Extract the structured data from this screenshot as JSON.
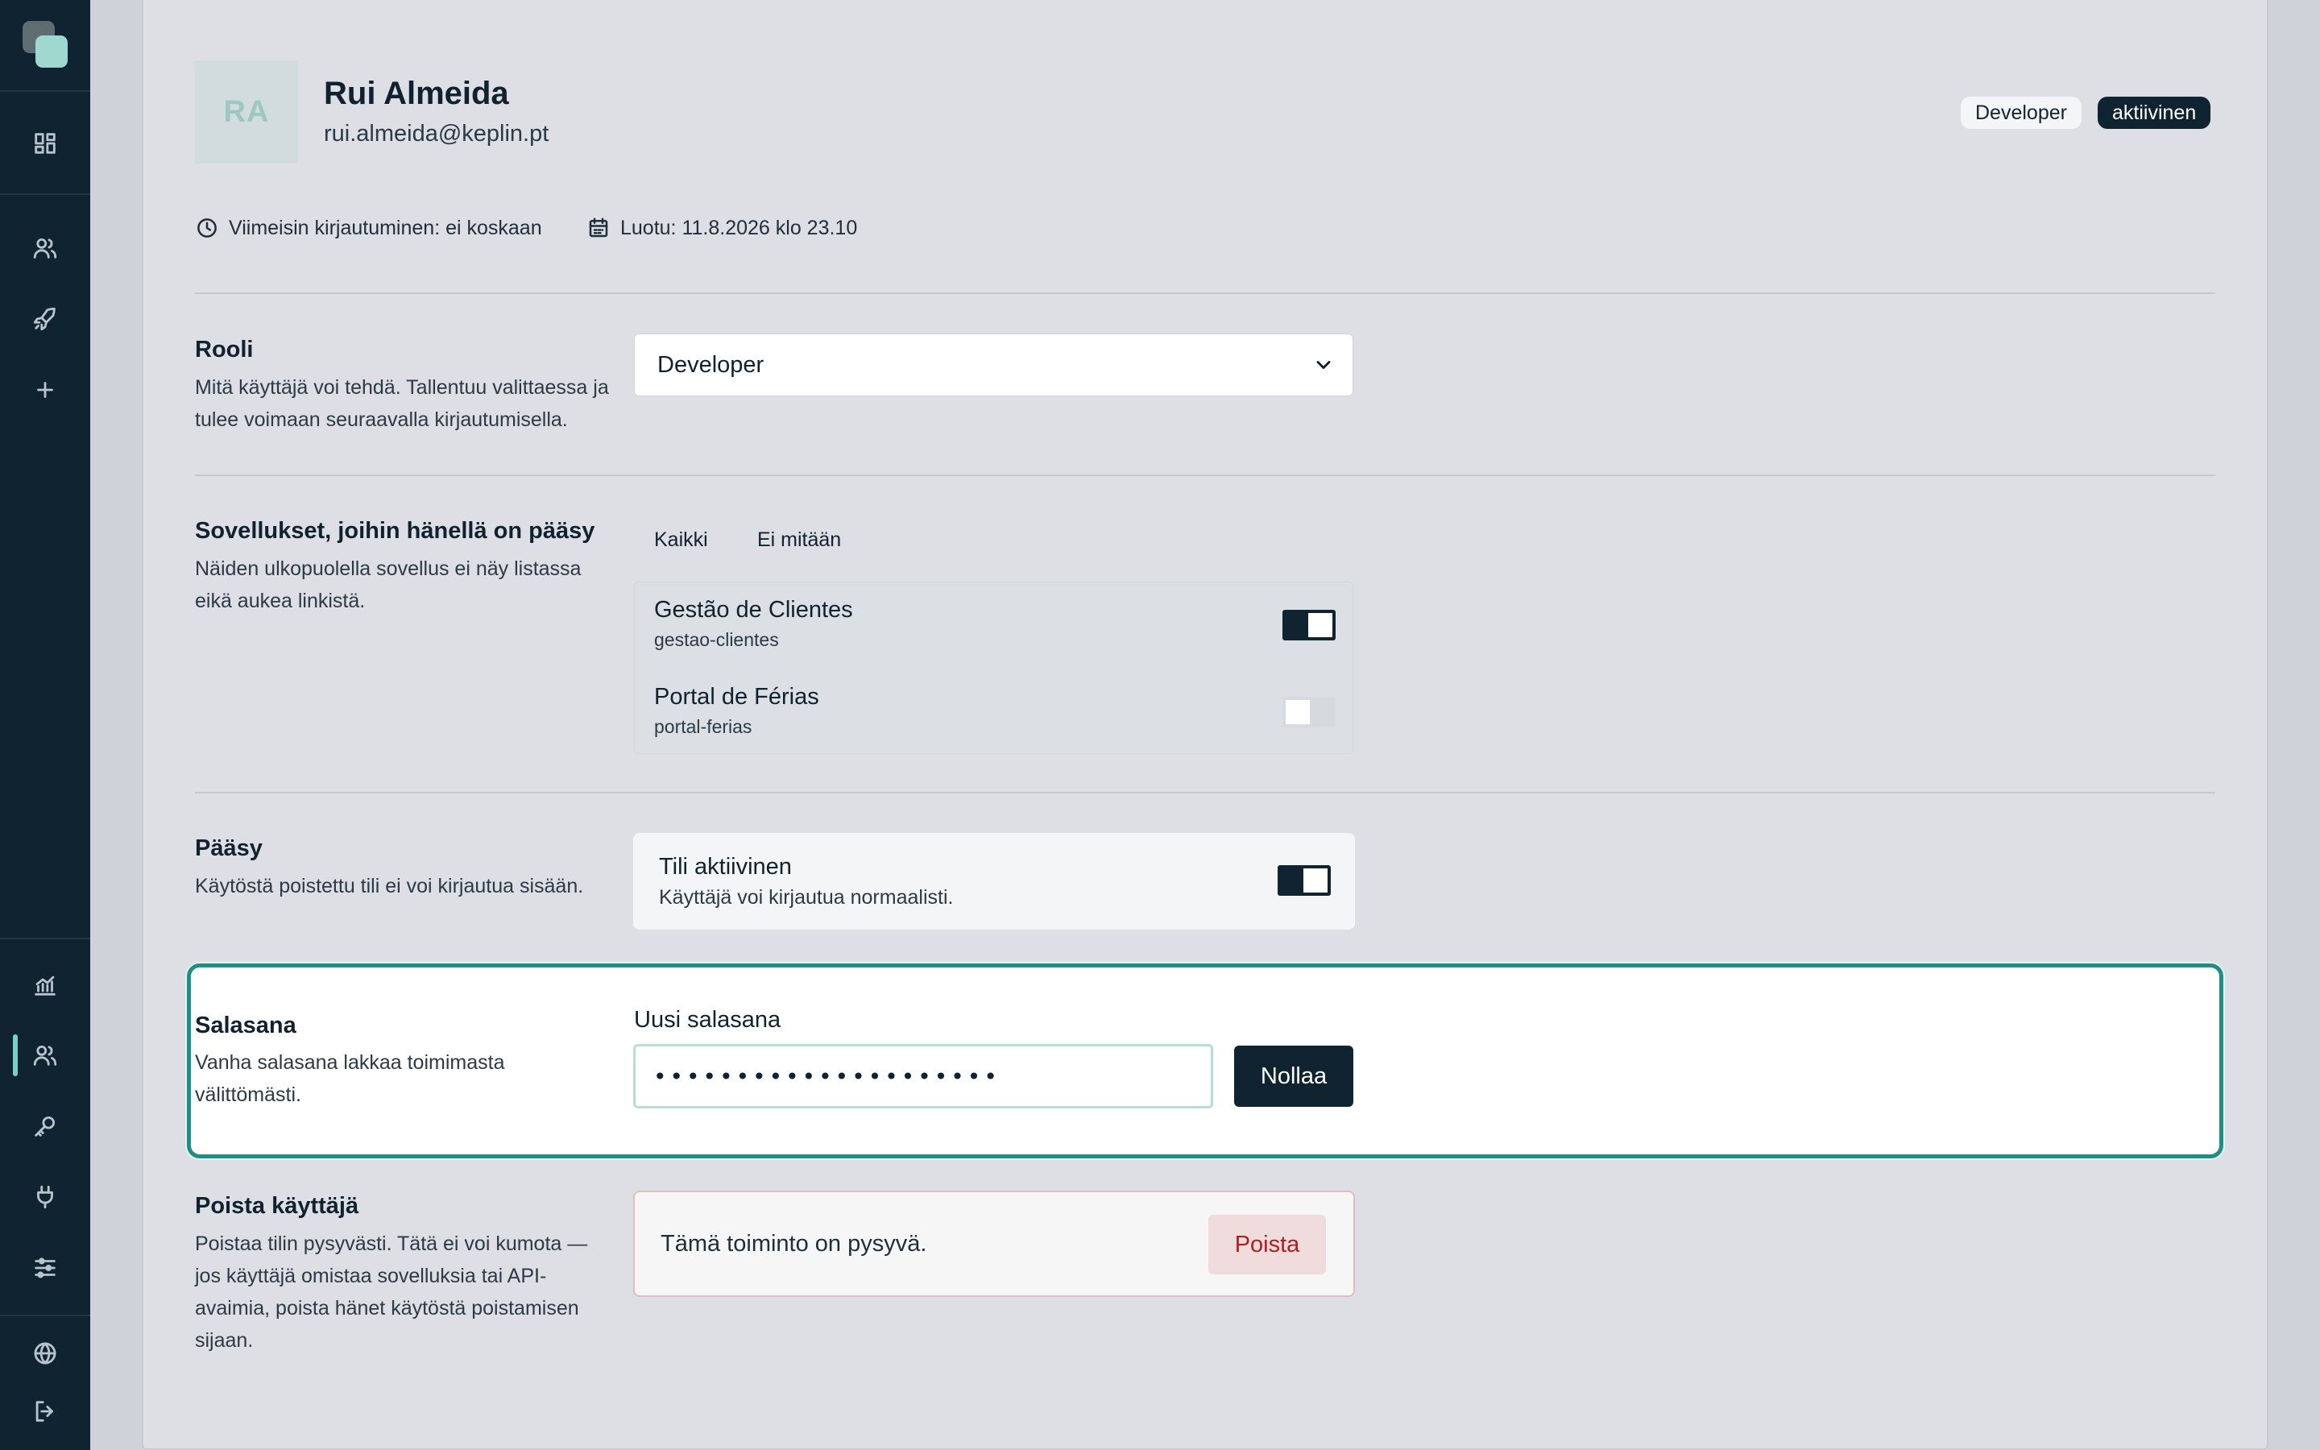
{
  "sidebar": {
    "icons": [
      "dashboard-icon",
      "users-icon",
      "rocket-icon",
      "plus-icon",
      "chart-icon",
      "users-active-icon",
      "key-icon",
      "plug-icon",
      "sliders-icon",
      "globe-icon",
      "logout-icon"
    ]
  },
  "user": {
    "initials": "RA",
    "name": "Rui Almeida",
    "email": "rui.almeida@keplin.pt",
    "role_badge": "Developer",
    "status_badge": "aktiivinen",
    "last_login": "Viimeisin kirjautuminen: ei koskaan",
    "created": "Luotu: 11.8.2026 klo 23.10"
  },
  "role": {
    "title": "Rooli",
    "desc": "Mitä käyttäjä voi tehdä. Tallentuu valittaessa ja tulee voimaan seuraavalla kirjautumisella.",
    "selected": "Developer"
  },
  "apps": {
    "title": "Sovellukset, joihin hänellä on pääsy",
    "desc": "Näiden ulkopuolella sovellus ei näy listassa eikä aukea linkistä.",
    "select_all": "Kaikki",
    "select_none": "Ei mitään",
    "items": [
      {
        "name": "Gestão de Clientes",
        "slug": "gestao-clientes",
        "enabled": true
      },
      {
        "name": "Portal de Férias",
        "slug": "portal-ferias",
        "enabled": false
      }
    ]
  },
  "access": {
    "title": "Pääsy",
    "desc": "Käytöstä poistettu tili ei voi kirjautua sisään.",
    "toggle_title": "Tili aktiivinen",
    "toggle_desc": "Käyttäjä voi kirjautua normaalisti.",
    "enabled": true
  },
  "password": {
    "title": "Salasana",
    "desc": "Vanha salasana lakkaa toimimasta välittömästi.",
    "field_label": "Uusi salasana",
    "value": "•••••••••••••••••••••",
    "button": "Nollaa"
  },
  "delete": {
    "title": "Poista käyttäjä",
    "desc": "Poistaa tilin pysyvästi. Tätä ei voi kumota — jos käyttäjä omistaa sovelluksia tai API-avaimia, poista hänet käytöstä poistamisen sijaan.",
    "warning": "Tämä toiminto on pysyvä.",
    "button": "Poista"
  },
  "colors": {
    "sidebar": "#0f2330",
    "accent": "#1d8f86",
    "danger": "#b01f1f"
  }
}
